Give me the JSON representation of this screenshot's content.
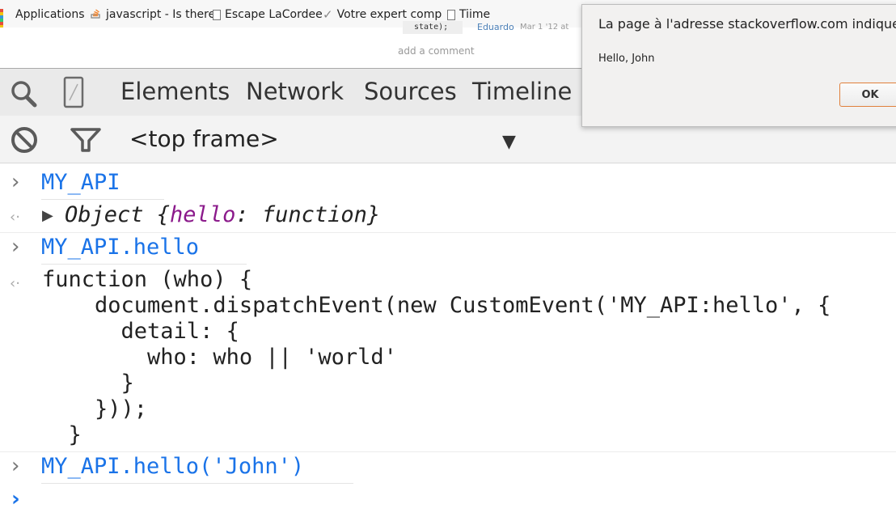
{
  "bookmarks": [
    {
      "label": "Applications",
      "icon": "apps-grid-icon"
    },
    {
      "label": "javascript - Is there",
      "icon": "stackoverflow-icon"
    },
    {
      "label": "Escape LaCordee",
      "icon": "page-icon"
    },
    {
      "label": "Votre expert comp",
      "icon": "checkmark-icon"
    },
    {
      "label": "Tiime",
      "icon": "page-icon"
    }
  ],
  "page_behind": {
    "code": "state);",
    "user": "Eduardo",
    "date": "Mar 1 '12 at",
    "add_comment": "add a comment"
  },
  "devtools": {
    "tabs": [
      "Elements",
      "Network",
      "Sources",
      "Timeline"
    ],
    "frame_select": "<top frame>"
  },
  "console": {
    "cmd1": "MY_API",
    "result1_prefix": "Object {",
    "result1_key": "hello",
    "result1_suffix": ": function}",
    "cmd2": "MY_API.hello",
    "code_lines": [
      "function (who) {",
      "    document.dispatchEvent(new CustomEvent('MY_API:hello', {",
      "      detail: {",
      "        who: who || 'world'",
      "      }",
      "    }));",
      "  }"
    ],
    "cmd3": "MY_API.hello('John')"
  },
  "alert": {
    "title": "La page à l'adresse stackoverflow.com indique :",
    "message": "Hello, John",
    "ok_label": "OK"
  },
  "colors": {
    "command_blue": "#1a73e8",
    "keyword_purple": "#8b1a8b",
    "ok_border": "#e0803c"
  }
}
